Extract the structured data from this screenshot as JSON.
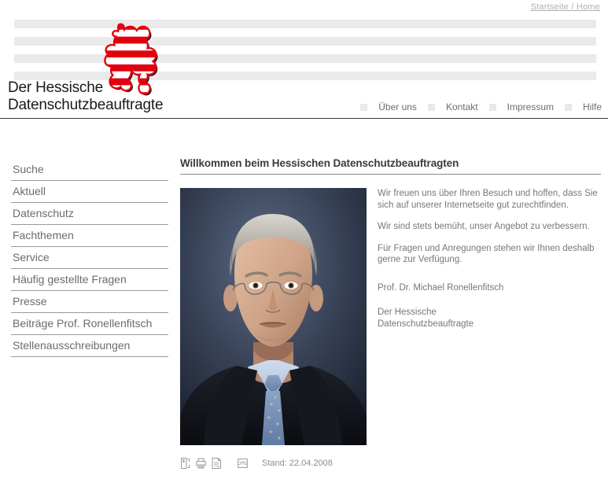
{
  "topbar": {
    "breadcrumb": "Startseite / Home"
  },
  "header": {
    "org_line1": "Der Hessische",
    "org_line2": "Datenschutzbeauftragte",
    "logo_alt": "hessen-lion-coat-of-arms",
    "nav": [
      {
        "label": "Über uns"
      },
      {
        "label": "Kontakt"
      },
      {
        "label": "Impressum"
      },
      {
        "label": "Hilfe"
      }
    ]
  },
  "sidebar": {
    "items": [
      {
        "label": "Suche"
      },
      {
        "label": "Aktuell"
      },
      {
        "label": "Datenschutz"
      },
      {
        "label": "Fachthemen"
      },
      {
        "label": "Service"
      },
      {
        "label": "Häufig gestellte Fragen"
      },
      {
        "label": "Presse"
      },
      {
        "label": "Beiträge Prof. Ronellenfitsch"
      },
      {
        "label": "Stellenausschreibungen"
      }
    ]
  },
  "main": {
    "title": "Willkommen beim Hessischen Datenschutzbeauftragten",
    "photo_alt": "portrait-prof-dr-michael-ronellenfitsch",
    "paragraphs": [
      "Wir freuen uns über Ihren Besuch und hoffen, dass Sie sich auf unserer Internetseite gut zurechtfinden.",
      "Wir sind stets bemüht, unser Angebot zu verbessern.",
      "Für Fragen und Anregungen stehen wir Ihnen deshalb gerne zur Verfügung."
    ],
    "signature_name": "Prof. Dr. Michael Ronellenfitsch",
    "signature_org_line1": "Der Hessische",
    "signature_org_line2": "Datenschutzbeauftragte"
  },
  "toolbar": {
    "icons": [
      {
        "name": "recommend-page-icon"
      },
      {
        "name": "print-icon"
      },
      {
        "name": "save-page-icon"
      },
      {
        "name": "jpg-badge-icon"
      }
    ],
    "stand_label": "Stand: 22.04.2008"
  },
  "colors": {
    "lion_red": "#e3000f",
    "stripe_gray": "#eaeaea",
    "rule_dark": "#3a3a3a",
    "text_gray": "#777777"
  }
}
